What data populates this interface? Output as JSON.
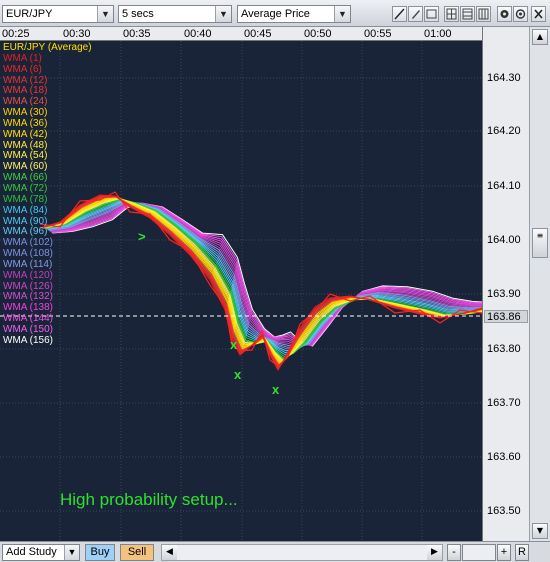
{
  "toolbar": {
    "symbol": "EUR/JPY",
    "interval": "5 secs",
    "price_type": "Average Price",
    "tool_icons": [
      "line-tool-icon",
      "pencil-icon",
      "grid-icon",
      "grid-icon",
      "grid-icon",
      "settings-icon",
      "camera-icon",
      "close-icon"
    ]
  },
  "time_axis": {
    "labels": [
      "00:25",
      "00:30",
      "00:35",
      "00:40",
      "00:45",
      "00:50",
      "00:55",
      "01:00"
    ]
  },
  "price_axis": {
    "labels": [
      "164.30",
      "164.20",
      "164.10",
      "164.00",
      "163.90",
      "163.80",
      "163.70",
      "163.60",
      "163.50"
    ],
    "current_price": "163.86"
  },
  "legend": {
    "title": "EUR/JPY (Average)",
    "items": [
      {
        "label": "WMA (1)",
        "color": "#e82020"
      },
      {
        "label": "WMA (6)",
        "color": "#e82828"
      },
      {
        "label": "WMA (12)",
        "color": "#e83030"
      },
      {
        "label": "WMA (18)",
        "color": "#e83838"
      },
      {
        "label": "WMA (24)",
        "color": "#e85040"
      },
      {
        "label": "WMA (30)",
        "color": "#ffd000"
      },
      {
        "label": "WMA (36)",
        "color": "#ffd800"
      },
      {
        "label": "WMA (42)",
        "color": "#ffe000"
      },
      {
        "label": "WMA (48)",
        "color": "#ffe838"
      },
      {
        "label": "WMA (54)",
        "color": "#fff040"
      },
      {
        "label": "WMA (60)",
        "color": "#fff060"
      },
      {
        "label": "WMA (66)",
        "color": "#40d040"
      },
      {
        "label": "WMA (72)",
        "color": "#38c838"
      },
      {
        "label": "WMA (78)",
        "color": "#30c040"
      },
      {
        "label": "WMA (84)",
        "color": "#40c8f0"
      },
      {
        "label": "WMA (90)",
        "color": "#50c8f0"
      },
      {
        "label": "WMA (96)",
        "color": "#60c8f0"
      },
      {
        "label": "WMA (102)",
        "color": "#7890e0"
      },
      {
        "label": "WMA (108)",
        "color": "#8090e0"
      },
      {
        "label": "WMA (114)",
        "color": "#8898e8"
      },
      {
        "label": "WMA (120)",
        "color": "#c040c0"
      },
      {
        "label": "WMA (126)",
        "color": "#c848c8"
      },
      {
        "label": "WMA (132)",
        "color": "#d050d0"
      },
      {
        "label": "WMA (138)",
        "color": "#f040e0"
      },
      {
        "label": "WMA (144)",
        "color": "#f050e8"
      },
      {
        "label": "WMA (150)",
        "color": "#f060f0"
      },
      {
        "label": "WMA (156)",
        "color": "#ffffff"
      }
    ]
  },
  "annotations": {
    "markers": [
      ">",
      "x",
      "x",
      "x"
    ],
    "note": "High probability setup..."
  },
  "bottom": {
    "add_study": "Add Study",
    "buy": "Buy",
    "sell": "Sell",
    "minus": "-",
    "plus": "+",
    "reset": "R"
  }
}
